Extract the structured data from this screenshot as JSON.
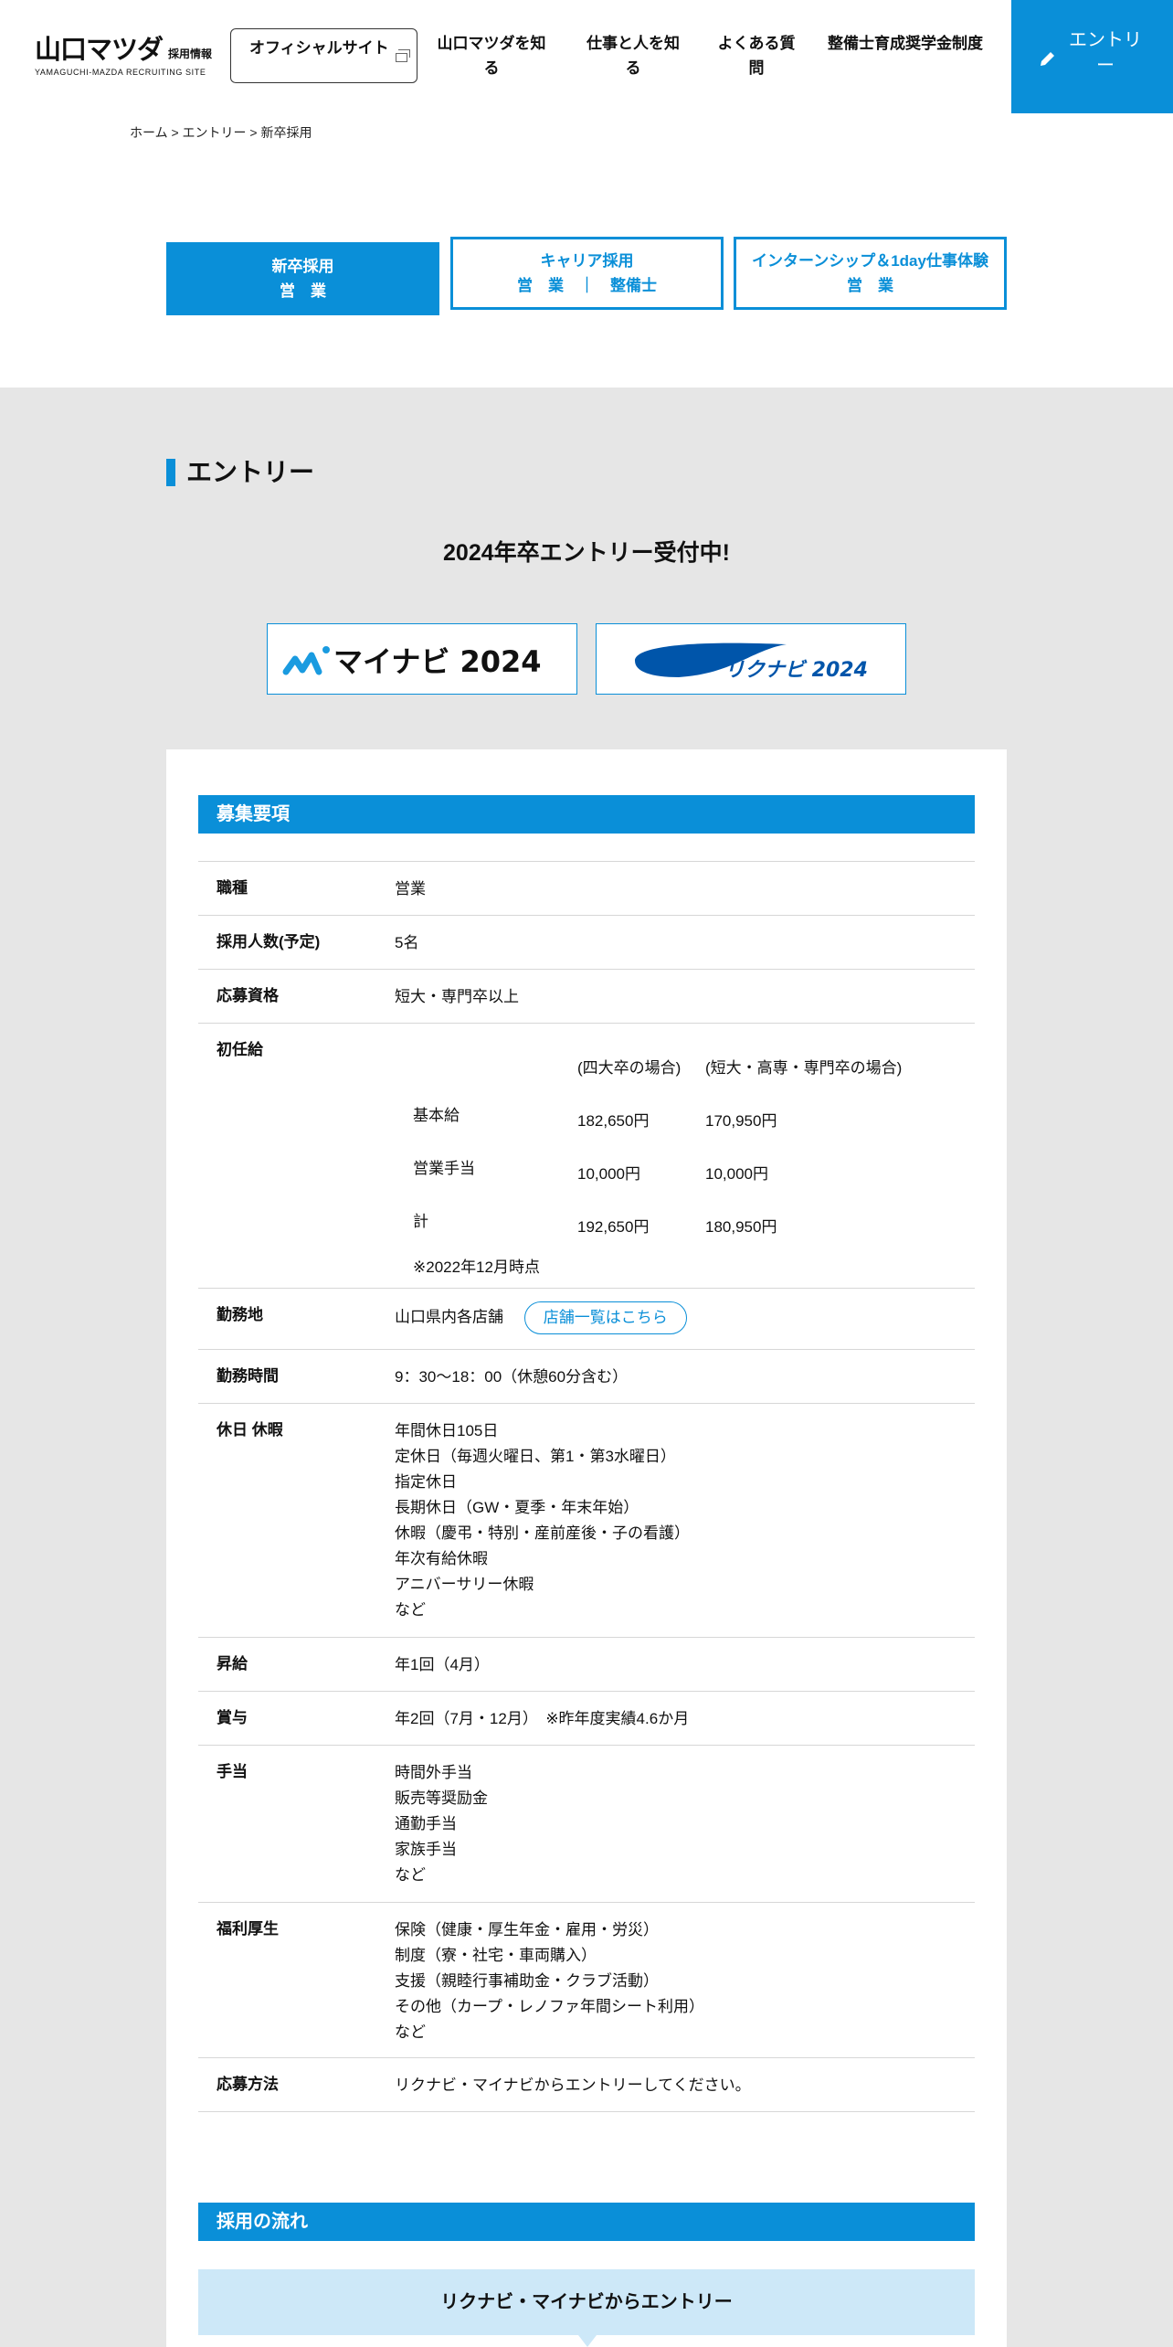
{
  "header": {
    "logo_main": "山口マツダ",
    "logo_sub": "採用情報",
    "logo_en": "YAMAGUCHI-MAZDA RECRUITING SITE",
    "official_site": "オフィシャルサイト",
    "nav": [
      "山口マツダを知る",
      "仕事と人を知る",
      "よくある質問",
      "整備士育成奨学金制度"
    ],
    "entry": "エントリー"
  },
  "breadcrumb": "ホーム > エントリー > 新卒採用",
  "tabs": [
    {
      "line1": "新卒採用",
      "line2": "営　業",
      "active": true
    },
    {
      "line1": "キャリア採用",
      "line2": "営　業　｜　整備士",
      "active": false
    },
    {
      "line1": "インターンシップ＆1day仕事体験",
      "line2": "営　業",
      "active": false
    }
  ],
  "section_title": "エントリー",
  "now_open": "2024年卒エントリー受付中!",
  "banners": {
    "mynavi": "マイナビ 2024",
    "rikunavi": "リクナビ 2024"
  },
  "recruit": {
    "heading": "募集要項",
    "job_label": "職種",
    "job_value": "営業",
    "count_label": "採用人数(予定)",
    "count_value": "5名",
    "qual_label": "応募資格",
    "qual_value": "短大・専門卒以上",
    "salary_label": "初任給",
    "salary_head1": "(四大卒の場合)",
    "salary_head2": "(短大・高専・専門卒の場合)",
    "salary_rows": [
      {
        "name": "基本給",
        "v1": "182,650円",
        "v2": "170,950円"
      },
      {
        "name": "営業手当",
        "v1": "10,000円",
        "v2": "10,000円"
      },
      {
        "name": "計",
        "v1": "192,650円",
        "v2": "180,950円"
      }
    ],
    "salary_note": "※2022年12月時点",
    "place_label": "勤務地",
    "place_value": "山口県内各店舗",
    "place_button": "店舗一覧はこちら",
    "hours_label": "勤務時間",
    "hours_value": "9：30～18：00（休憩60分含む）",
    "holiday_label": "休日 休暇",
    "holiday_lines": [
      "年間休日105日",
      "定休日（毎週火曜日、第1・第3水曜日）",
      "指定休日",
      "長期休日（GW・夏季・年末年始）",
      "休暇（慶弔・特別・産前産後・子の看護）",
      "年次有給休暇",
      "アニバーサリー休暇",
      "など"
    ],
    "raise_label": "昇給",
    "raise_value": "年1回（4月）",
    "bonus_label": "賞与",
    "bonus_value": "年2回（7月・12月）　※昨年度実績4.6か月",
    "allow_label": "手当",
    "allow_lines": [
      "時間外手当",
      "販売等奨励金",
      "通勤手当",
      "家族手当",
      "など"
    ],
    "welfare_label": "福利厚生",
    "welfare_lines": [
      "保険（健康・厚生年金・雇用・労災）",
      "制度（寮・社宅・車両購入）",
      "支援（親睦行事補助金・クラブ活動）",
      "その他（カープ・レノファ年間シート利用）",
      "など"
    ],
    "apply_label": "応募方法",
    "apply_value": "リクナビ・マイナビからエントリーしてください。"
  },
  "flow": {
    "heading": "採用の流れ",
    "step1": "リクナビ・マイナビからエントリー"
  },
  "colors": {
    "accent": "#0a8fd8",
    "gray_bg": "#e6e6e6",
    "flow_bg": "#cde8f8"
  }
}
